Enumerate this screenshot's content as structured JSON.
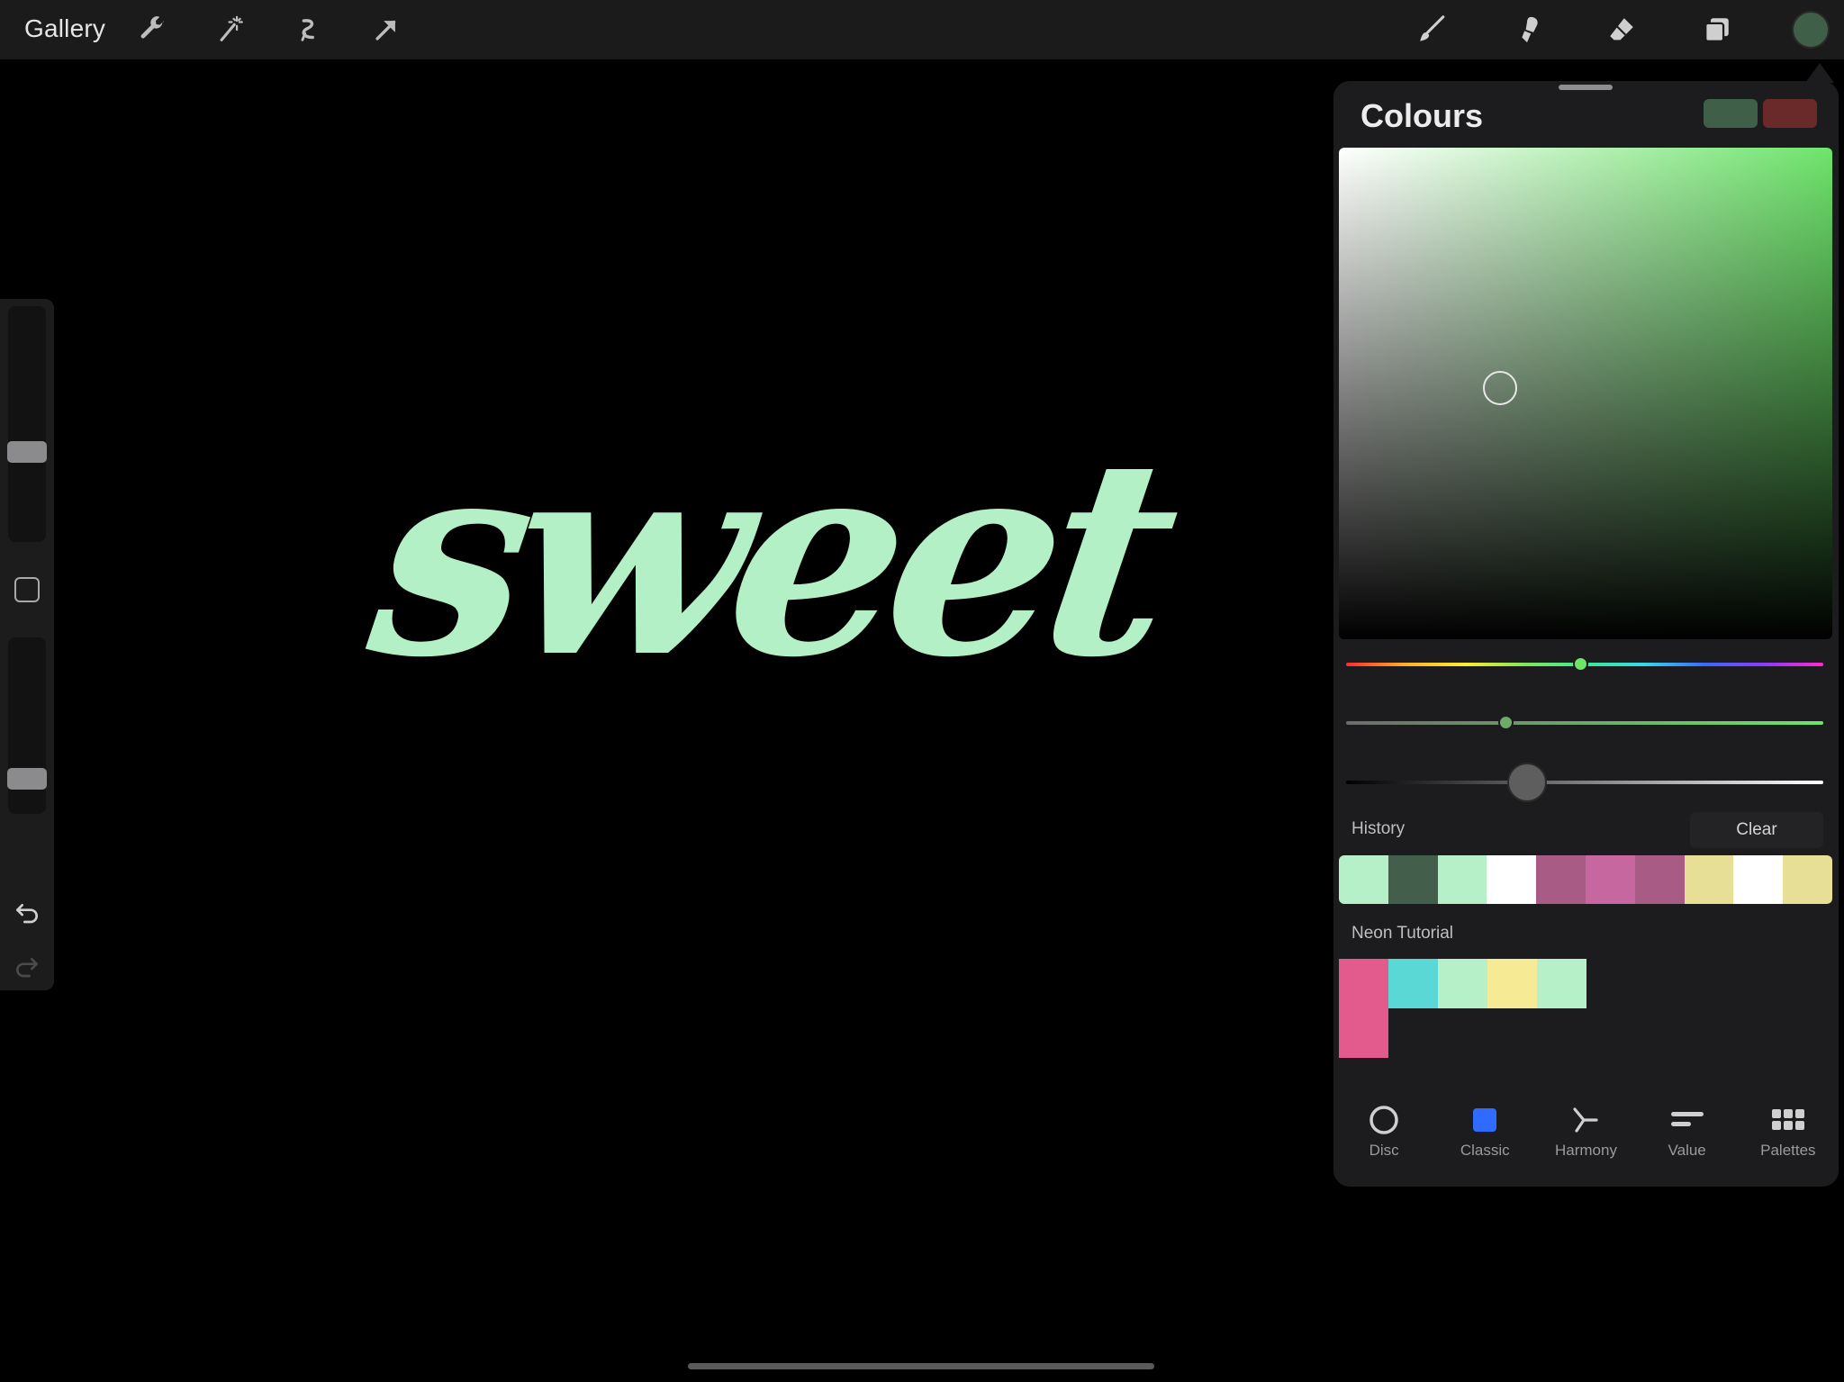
{
  "topbar": {
    "gallery_label": "Gallery",
    "left_tools": [
      "wrench-icon",
      "magic-wand-icon",
      "selection-icon",
      "transform-arrow-icon"
    ],
    "right_tools": [
      "brush-icon",
      "smudge-icon",
      "eraser-icon",
      "layers-icon"
    ],
    "current_colour": "#3f5f48"
  },
  "sidebar": {
    "size_slider": {
      "level": 0.38
    },
    "opacity_slider": {
      "level": 0.2
    },
    "controls": [
      "modify-square-icon",
      "undo-icon",
      "redo-icon"
    ]
  },
  "canvas": {
    "artwork_text": "sweet",
    "artwork_colour": "#b3f0c6"
  },
  "colours_panel": {
    "title": "Colours",
    "current_colour": "#3f5f48",
    "previous_colour": "#6a2a2a",
    "hue_colour": "#6ee46b",
    "hue_level": 0.52,
    "saturation_level": 0.32,
    "brightness_level": 0.33,
    "history": {
      "label": "History",
      "clear_label": "Clear",
      "swatches": [
        "#b6f0c8",
        "#445e4c",
        "#b6f0c8",
        "#ffffff",
        "#a85b85",
        "#c667a0",
        "#a85b85",
        "#e8df96",
        "#ffffff",
        "#e8df96"
      ]
    },
    "palette": {
      "label": "Neon Tutorial",
      "swatches": [
        "#e35a8c",
        "#5ad8d6",
        "#b6f0c8",
        "#f7ea94",
        "#b6f0c8",
        "#e35a8c"
      ]
    },
    "tabs": [
      {
        "label": "Disc",
        "icon": "disc-icon"
      },
      {
        "label": "Classic",
        "icon": "classic-square-icon",
        "active": true
      },
      {
        "label": "Harmony",
        "icon": "harmony-icon"
      },
      {
        "label": "Value",
        "icon": "value-sliders-icon"
      },
      {
        "label": "Palettes",
        "icon": "palettes-grid-icon"
      }
    ],
    "active_tab_colour": "#2f6bff"
  }
}
